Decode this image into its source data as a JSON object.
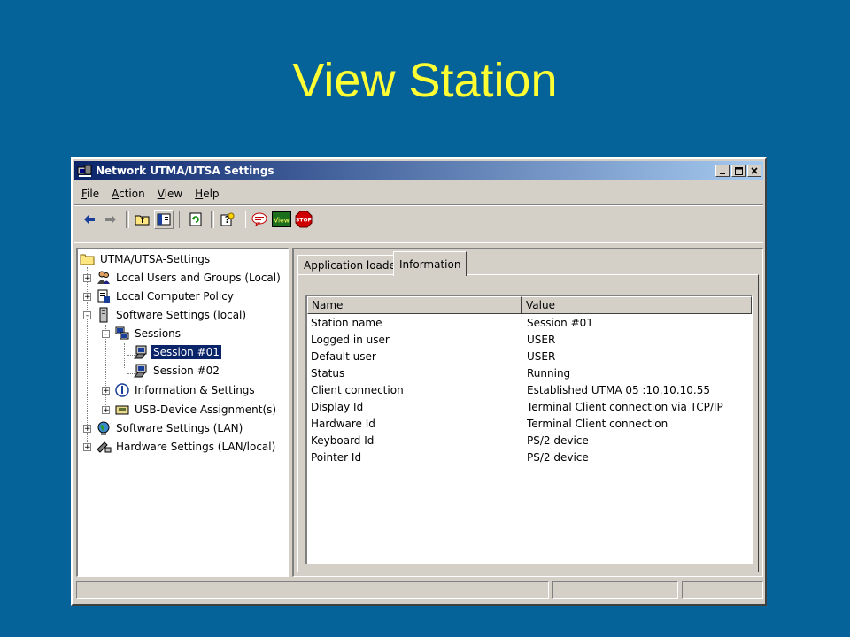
{
  "slide": {
    "title": "View Station"
  },
  "window": {
    "title": "Network UTMA/UTSA Settings",
    "caption_buttons": [
      "minimize-icon",
      "restore-icon",
      "close-icon"
    ]
  },
  "menu": {
    "items": [
      {
        "label": "File",
        "mnemonic": "F"
      },
      {
        "label": "Action",
        "mnemonic": "A"
      },
      {
        "label": "View",
        "mnemonic": "V"
      },
      {
        "label": "Help",
        "mnemonic": "H"
      }
    ]
  },
  "toolbar": {
    "buttons": [
      "back-arrow-icon",
      "forward-arrow-icon",
      "up-folder-icon",
      "show-hide-tree-icon",
      "refresh-icon",
      "help-icon",
      "message-icon",
      "view-icon",
      "stop-icon"
    ],
    "view_label": "View",
    "stop_label": "STOP"
  },
  "tree": {
    "root": "UTMA/UTSA-Settings",
    "items": [
      {
        "label": "Local Users and Groups (Local)",
        "icon": "users-icon",
        "expander": "+"
      },
      {
        "label": "Local Computer Policy",
        "icon": "policy-icon",
        "expander": "+"
      },
      {
        "label": "Software Settings (local)",
        "icon": "computer-icon",
        "expander": "-"
      },
      {
        "label": "Sessions",
        "icon": "sessions-icon",
        "expander": "-"
      },
      {
        "label": "Session #01",
        "icon": "terminal-icon",
        "selected": true
      },
      {
        "label": "Session #02",
        "icon": "terminal-icon"
      },
      {
        "label": "Information & Settings",
        "icon": "info-icon",
        "expander": "+"
      },
      {
        "label": "USB-Device Assignment(s)",
        "icon": "usb-icon",
        "expander": "+"
      },
      {
        "label": "Software Settings (LAN)",
        "icon": "globe-icon",
        "expander": "+"
      },
      {
        "label": "Hardware Settings (LAN/local)",
        "icon": "hardware-icon",
        "expander": "+"
      }
    ]
  },
  "tabs": [
    {
      "label": "Application loaded",
      "active": false
    },
    {
      "label": "Information",
      "active": true
    }
  ],
  "table": {
    "columns": [
      "Name",
      "Value"
    ],
    "rows": [
      [
        "Station name",
        "Session #01"
      ],
      [
        "Logged in user",
        "USER"
      ],
      [
        "Default user",
        "USER"
      ],
      [
        "Status",
        "Running"
      ],
      [
        "Client connection",
        "Established UTMA 05 :10.10.10.55"
      ],
      [
        "Display Id",
        "Terminal Client connection via TCP/IP"
      ],
      [
        "Hardware Id",
        "Terminal Client connection"
      ],
      [
        "Keyboard Id",
        "PS/2 device"
      ],
      [
        "Pointer Id",
        "PS/2 device"
      ]
    ]
  },
  "colors": {
    "slide_background": "#056399",
    "title_text": "#ffff33",
    "titlebar_start": "#0a246a",
    "titlebar_end": "#a6caf0",
    "selection": "#0a246a",
    "window_face": "#d4d0c8"
  }
}
